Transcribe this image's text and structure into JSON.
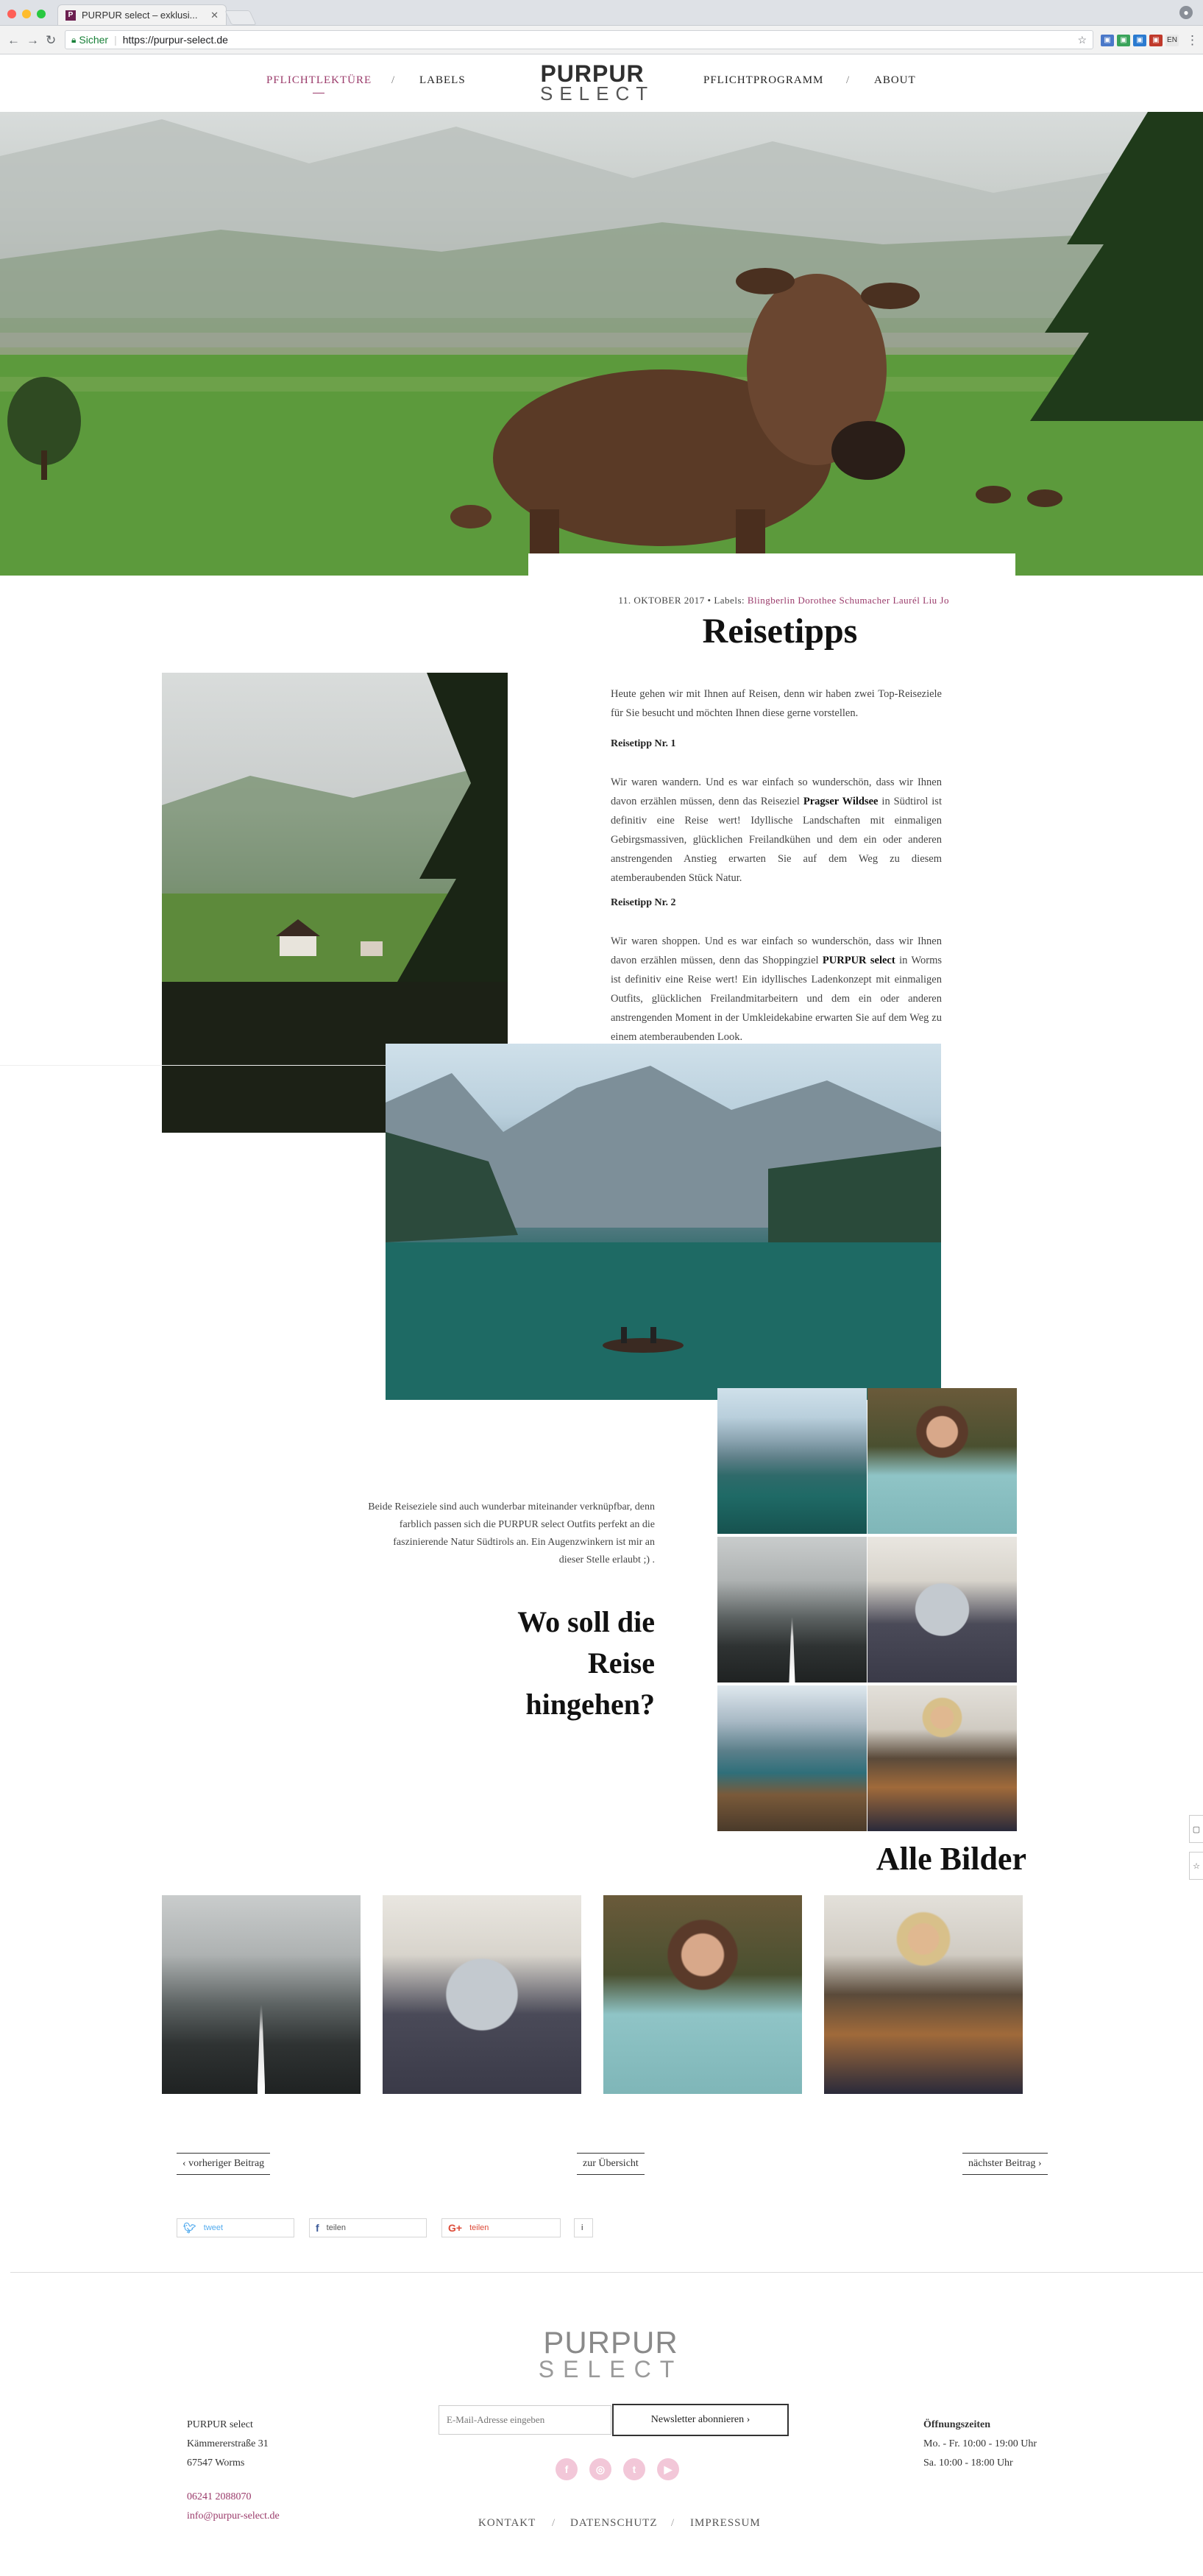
{
  "browser": {
    "tab_title": "PURPUR select – exklusi...",
    "tab_favicon": "P",
    "secure_label": "Sicher",
    "url": "https://purpur-select.de",
    "profile_initial": "",
    "ext_label": "EN"
  },
  "nav": {
    "items": [
      "PFLICHTLEKTÜRE",
      "LABELS",
      "PFLICHTPROGRAMM",
      "ABOUT"
    ],
    "separator": "/",
    "logo_line1": "PURPUR",
    "logo_line2": "SELECT"
  },
  "article": {
    "date": "11. OKTOBER 2017",
    "labels_prefix": " • Labels:",
    "labels": " Blingberlin Dorothee Schumacher Laurél Liu Jo",
    "title": "Reisetipps",
    "intro": "Heute gehen wir mit Ihnen auf Reisen, denn wir haben zwei Top-Reiseziele für Sie besucht und möchten Ihnen diese gerne vorstellen.",
    "tip1_head": "Reisetipp Nr. 1",
    "tip1_a": "Wir waren wandern. Und es war einfach so wunderschön, dass wir Ihnen davon erzählen müssen, denn das Reiseziel ",
    "tip1_bold": "Pragser Wildsee",
    "tip1_b": " in Südtirol ist definitiv eine Reise wert! Idyllische Landschaften mit einmaligen Gebirgsmassiven, glücklichen Freilandkühen und dem ein oder anderen anstrengenden Anstieg erwarten Sie auf dem Weg zu diesem atemberaubenden Stück Natur.",
    "tip2_head": "Reisetipp Nr. 2",
    "tip2_a": "Wir waren shoppen. Und es war einfach so wunderschön, dass wir Ihnen davon erzählen müssen, denn das Shoppingziel ",
    "tip2_bold": "PURPUR select",
    "tip2_b": " in Worms ist definitiv eine Reise wert! Ein idyllisches Ladenkonzept mit einmaligen Outfits, glücklichen Freilandmitarbeitern und dem ein oder anderen anstrengenden Moment in der Umkleidekabine erwarten Sie auf dem Weg zu einem atemberaubenden Look.",
    "combo_text": "Beide Reiseziele sind auch wunderbar miteinander verknüpfbar, denn farblich passen sich die PURPUR select Outfits perfekt an die faszinierende Natur Südtirols an. Ein Augenzwinkern ist mir an dieser Stelle erlaubt ;) .",
    "question": "Wo soll die Reise hingehen?",
    "all_pictures": "Alle Bilder"
  },
  "postnav": {
    "prev": "‹ vorheriger Beitrag",
    "overview": "zur Übersicht",
    "next": "nächster Beitrag ›"
  },
  "share": {
    "tweet": "tweet",
    "facebook": "teilen",
    "google": "teilen",
    "info": "i"
  },
  "footer": {
    "logo_line1": "PURPUR",
    "logo_line2": "SELECT",
    "address": [
      "PURPUR select",
      "Kämmererstraße 31",
      "67547 Worms"
    ],
    "phone": "06241 2088070",
    "email": "info@purpur-select.de",
    "email_placeholder": "E-Mail-Adresse eingeben",
    "subscribe_label": "Newsletter abonnieren ›",
    "hours_title": "Öffnungszeiten",
    "hours": [
      "Mo. - Fr. 10:00 - 19:00 Uhr",
      "Sa. 10:00 - 18:00 Uhr"
    ],
    "social": [
      "f",
      "◎",
      "t",
      "▶"
    ],
    "links": [
      "KONTAKT",
      "DATENSCHUTZ",
      "IMPRESSUM"
    ],
    "separator": "/"
  },
  "colors": {
    "accent": "#9a3a6a",
    "social": "#f2c7d8"
  }
}
